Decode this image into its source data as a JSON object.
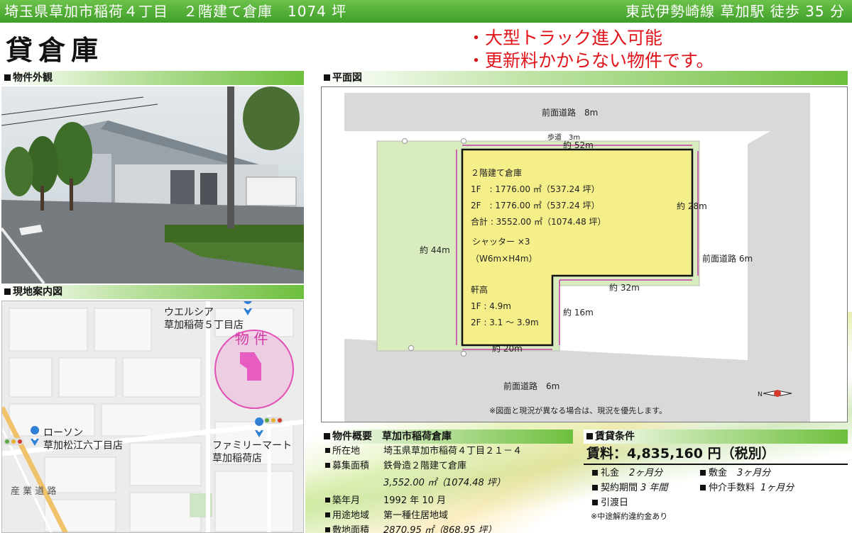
{
  "header": {
    "address_title": "埼玉県草加市稲荷４丁目　２階建て倉庫　1074 坪",
    "access": "東武伊勢崎線 草加駅 徒歩 35 分"
  },
  "title": "貸倉庫",
  "features": [
    "大型トラック進入可能",
    "更新料かからない物件です。"
  ],
  "sections": {
    "exterior": "物件外観",
    "floorplan": "平面図",
    "map": "現地案内図",
    "overview": "物件概要　草加市稲荷倉庫",
    "terms": "賃貸条件"
  },
  "map": {
    "welcia": "ウエルシア",
    "welcia_branch": "草加稲荷５丁目店",
    "property": "物 件",
    "lawson": "ローソン",
    "lawson_branch": "草加松江六丁目店",
    "familymart": "ファミリーマート",
    "familymart_branch": "草加稲荷店",
    "road": "産 業 道 路"
  },
  "plan": {
    "front_road_top": "前面道路　8m",
    "sidewalk": "歩道　3m",
    "width_52": "約 52m",
    "building_name": "２階建て倉庫",
    "floor1": "1F　: 1776.00 ㎡（537.24 坪）",
    "floor2": "2F　: 1776.00 ㎡（537.24 坪）",
    "total": "合計 : 3552.00 ㎡（1074.48 坪）",
    "shutter": "シャッター ×3",
    "shutter_size": "（W6m×H4m）",
    "eaves": "軒高",
    "eaves1": "1F : 4.9m",
    "eaves2": "2F : 3.1 ～ 3.9m",
    "depth_44": "約 44m",
    "depth_28": "約 28m",
    "front_road_right": "前面道路 6m",
    "width_32": "約 32m",
    "depth_16": "約 16m",
    "width_20": "約 20m",
    "front_road_bottom": "前面道路　6m",
    "compass": "N",
    "note": "※図面と現況が異なる場合は、現況を優先します。"
  },
  "overview": [
    {
      "label": "所在地",
      "value": "埼玉県草加市稲荷４丁目２１－４",
      "italic": false
    },
    {
      "label": "募集面積",
      "value": "鉄骨造２階建て倉庫",
      "italic": false
    },
    {
      "label": "",
      "value": "3,552.00 ㎡（1074.48 坪）",
      "italic": true
    },
    {
      "label": "築年月",
      "value": "1992 年 10 月",
      "italic": false
    },
    {
      "label": "用途地域",
      "value": "第一種住居地域",
      "italic": false
    },
    {
      "label": "敷地面積",
      "value": "2870.95 ㎡（868.95 坪）",
      "italic": true
    }
  ],
  "terms": {
    "rent": "賃料：4,835,160 円（税別）",
    "key_money_label": "礼金",
    "key_money": "2ヶ月分",
    "deposit_label": "敷金",
    "deposit": "3ヶ月分",
    "contract_label": "契約期間",
    "contract": "3 年間",
    "broker_label": "仲介手数料",
    "broker": "1ヶ月分",
    "handover_label": "引渡日",
    "note": "※中途解約違約金あり"
  },
  "colors": {
    "green_bar": "#4fae33",
    "red_text": "#e0151c",
    "building_fill": "#f5ef8a",
    "site_fill": "#d8ecbf",
    "dimension": "#c43aa6",
    "property_circle": "#f07cc5"
  }
}
